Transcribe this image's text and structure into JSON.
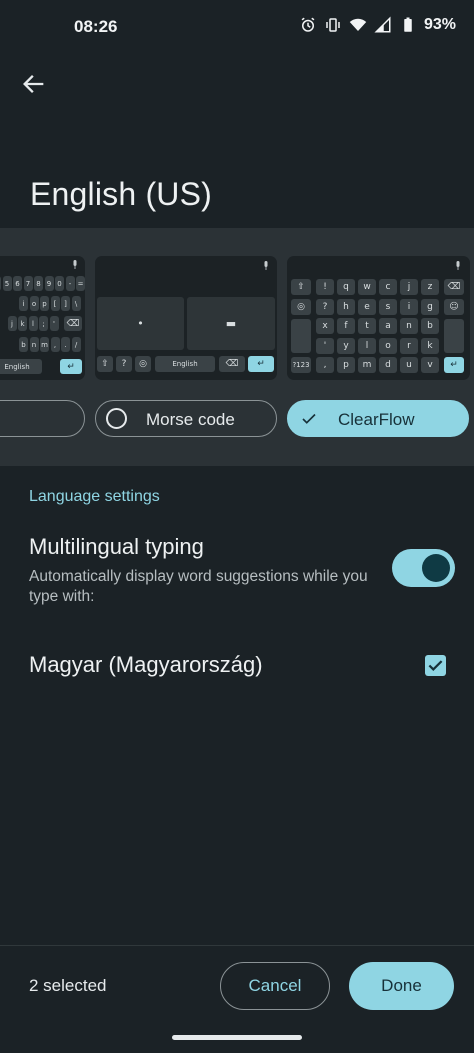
{
  "status_bar": {
    "time": "08:26",
    "battery": "93%",
    "icons": [
      "alarm-icon",
      "vibrate-icon",
      "wifi-icon",
      "signal-icon",
      "battery-icon"
    ]
  },
  "header": {
    "title": "English (US)",
    "back_icon": "arrow-back-icon"
  },
  "layouts": {
    "left_preview": {
      "rows": [
        [
          "4",
          "5",
          "6",
          "7",
          "8",
          "9",
          "0",
          "-",
          "="
        ],
        [
          "i",
          "o",
          "p",
          "[",
          "]",
          "\\"
        ],
        [
          "j",
          "k",
          "l",
          ";",
          "'"
        ],
        [
          "b",
          "n",
          "m",
          ",",
          ".",
          "/"
        ]
      ],
      "space_label": "English"
    },
    "morse_preview": {
      "dot": "•",
      "dash": "▬",
      "space_label": "English",
      "bottom_keys": [
        "⇧",
        "?",
        "🌐"
      ]
    },
    "clearflow_preview": {
      "rows": [
        [
          "!",
          "q",
          "w",
          "c",
          "j",
          "z"
        ],
        [
          "?",
          "h",
          "e",
          "s",
          "i",
          "g"
        ],
        [
          "x",
          "f",
          "t",
          "a",
          "n",
          "b"
        ],
        [
          "'",
          "y",
          "l",
          "o",
          "r",
          "k"
        ],
        [
          ",",
          "p",
          "m",
          "d",
          "u",
          "v"
        ]
      ],
      "symbols_label": "?123"
    },
    "options": [
      {
        "label": "",
        "selected": false
      },
      {
        "label": "Morse code",
        "selected": false
      },
      {
        "label": "ClearFlow",
        "selected": true
      }
    ]
  },
  "settings": {
    "section_header": "Language settings",
    "multilingual_title": "Multilingual typing",
    "multilingual_desc": "Automatically display word suggestions while you type with:",
    "multilingual_enabled": true,
    "languages": [
      {
        "label": "Magyar (Magyarország)",
        "checked": true
      }
    ]
  },
  "footer": {
    "selected_text": "2 selected",
    "cancel_label": "Cancel",
    "done_label": "Done"
  },
  "colors": {
    "background": "#1b2226",
    "accent": "#8fd5e3",
    "band": "#2b3236"
  }
}
